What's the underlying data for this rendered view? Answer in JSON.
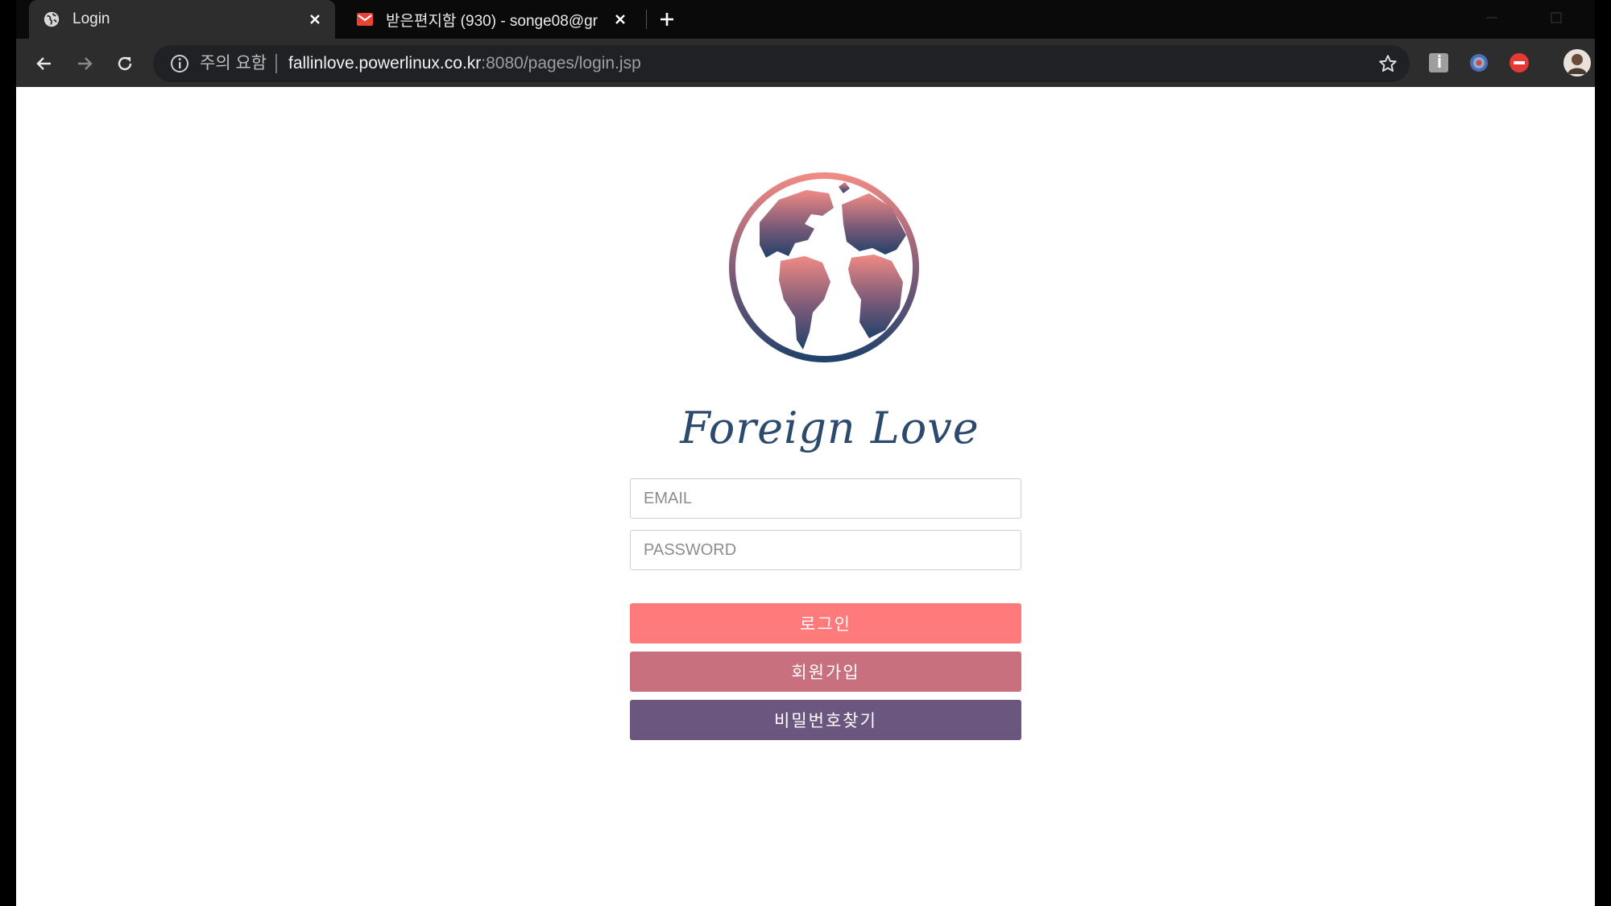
{
  "tabs": [
    {
      "title": "Login",
      "favicon": "globe-icon",
      "active": true
    },
    {
      "title": "받은편지함 (930) - songe08@gr",
      "favicon": "gmail-icon",
      "active": false
    }
  ],
  "address_bar": {
    "security_label": "주의 요함",
    "url_host": "fallinlove.powerlinux.co.kr",
    "url_path": ":8080/pages/login.jsp"
  },
  "login": {
    "brand_name": "Foreign Love",
    "email_placeholder": "EMAIL",
    "password_placeholder": "PASSWORD",
    "login_label": "로그인",
    "signup_label": "회원가입",
    "find_password_label": "비밀번호찾기"
  },
  "colors": {
    "login_button": "#ff7a7a",
    "signup_button": "#c9707e",
    "find_password_button": "#6b5680",
    "brand_text": "#2c4a6e",
    "globe_top": "#f08a84",
    "globe_bottom": "#22426a"
  }
}
